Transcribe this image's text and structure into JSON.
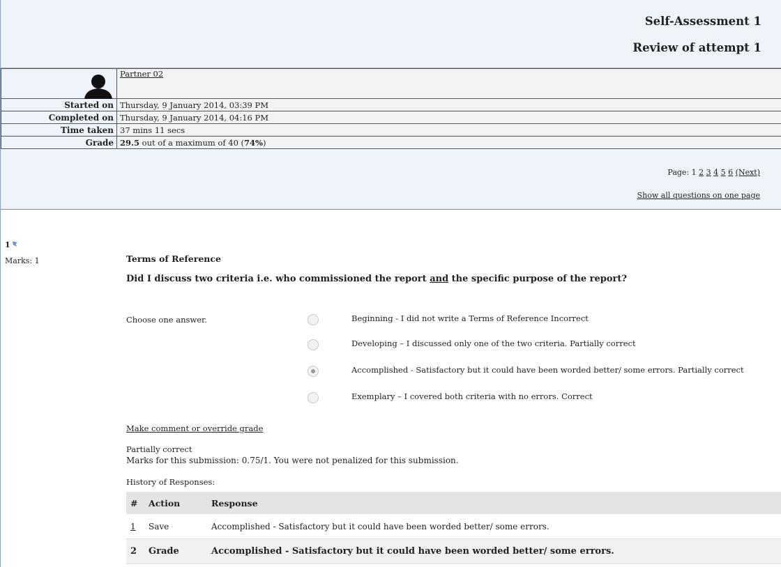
{
  "header": {
    "title": "Self-Assessment 1",
    "subtitle": "Review of attempt 1"
  },
  "summary": {
    "user_name": "Partner 02",
    "rows": [
      {
        "label": "Started on",
        "value": "Thursday, 9 January 2014, 03:39 PM"
      },
      {
        "label": "Completed on",
        "value": "Thursday, 9 January 2014, 04:16 PM"
      },
      {
        "label": "Time taken",
        "value": "37 mins 11 secs"
      }
    ],
    "grade_label": "Grade",
    "grade_score": "29.5",
    "grade_rest": " out of a maximum of 40 (",
    "grade_pct": "74%",
    "grade_end": ")"
  },
  "pager": {
    "label": "Page:",
    "current": "1",
    "pages": [
      "2",
      "3",
      "4",
      "5",
      "6"
    ],
    "next": "(Next)",
    "show_all": "Show all questions on one page"
  },
  "question": {
    "number": "1",
    "marks": "Marks: 1",
    "title": "Terms of Reference",
    "prompt_a": "Did I discuss two criteria i.e. who commissioned the report ",
    "prompt_and": "and",
    "prompt_b": " the specific purpose of the report?",
    "choose": "Choose one answer.",
    "options": [
      {
        "text": "Beginning - I did not write a Terms of Reference",
        "feedback": "Incorrect",
        "selected": false
      },
      {
        "text": "Developing – I discussed only one of the two criteria.",
        "feedback": "Partially correct",
        "selected": false
      },
      {
        "text": "Accomplished - Satisfactory but it could have been worded better/ some errors.",
        "feedback": "Partially correct",
        "selected": true
      },
      {
        "text": "Exemplary – I covered both criteria with no errors.",
        "feedback": "Correct",
        "selected": false
      }
    ],
    "comment_link": "Make comment or override grade",
    "result": "Partially correct",
    "marks_line": "Marks for this submission: 0.75/1. You were not penalized for this submission.",
    "history_label": "History of Responses:",
    "history_headers": [
      "#",
      "Action",
      "Response"
    ],
    "history": [
      {
        "num": "1",
        "action": "Save",
        "response": "Accomplished - Satisfactory but it could have been worded better/ some errors."
      },
      {
        "num": "2",
        "action": "Grade",
        "response": "Accomplished - Satisfactory but it could have been worded better/ some errors."
      }
    ]
  }
}
